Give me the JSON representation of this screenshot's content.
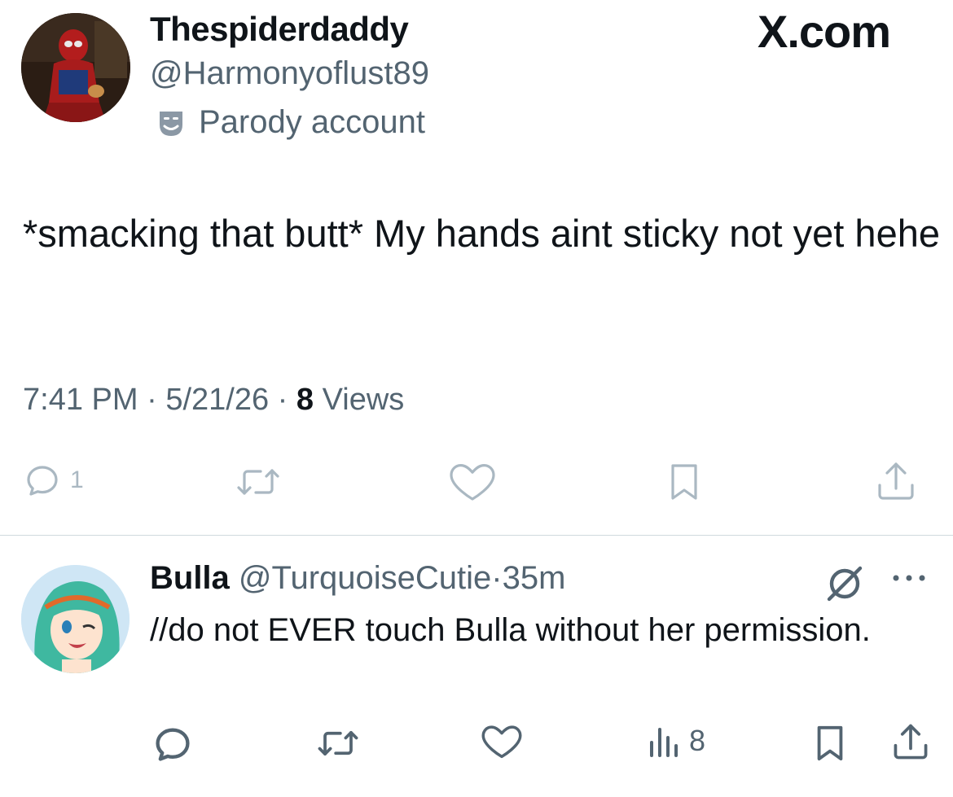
{
  "main_tweet": {
    "display_name": "Thespiderdaddy",
    "handle": "@Harmonyoflust89",
    "parody_label": "Parody account",
    "brand": "X.com",
    "text": "*smacking that butt* My hands aint sticky not yet hehe",
    "time": "7:41 PM",
    "date": "5/21/26",
    "views_count": "8",
    "views_label": "Views",
    "reply_count": "1",
    "icons": [
      "reply-icon",
      "repost-icon",
      "like-icon",
      "bookmark-icon",
      "share-icon",
      "parody-mask-icon"
    ]
  },
  "reply": {
    "display_name": "Bulla",
    "handle": "@TurquoiseCutie",
    "time": "35m",
    "text": "//do not EVER touch Bulla without her permission.",
    "views_count": "8",
    "icons": [
      "grok-icon",
      "more-icon",
      "reply-icon",
      "repost-icon",
      "like-icon",
      "views-icon",
      "bookmark-icon",
      "share-icon"
    ]
  },
  "colors": {
    "text_primary": "#0f1419",
    "text_secondary": "#536471",
    "action_faded": "#aab8c2",
    "divider": "#cfd9de"
  }
}
